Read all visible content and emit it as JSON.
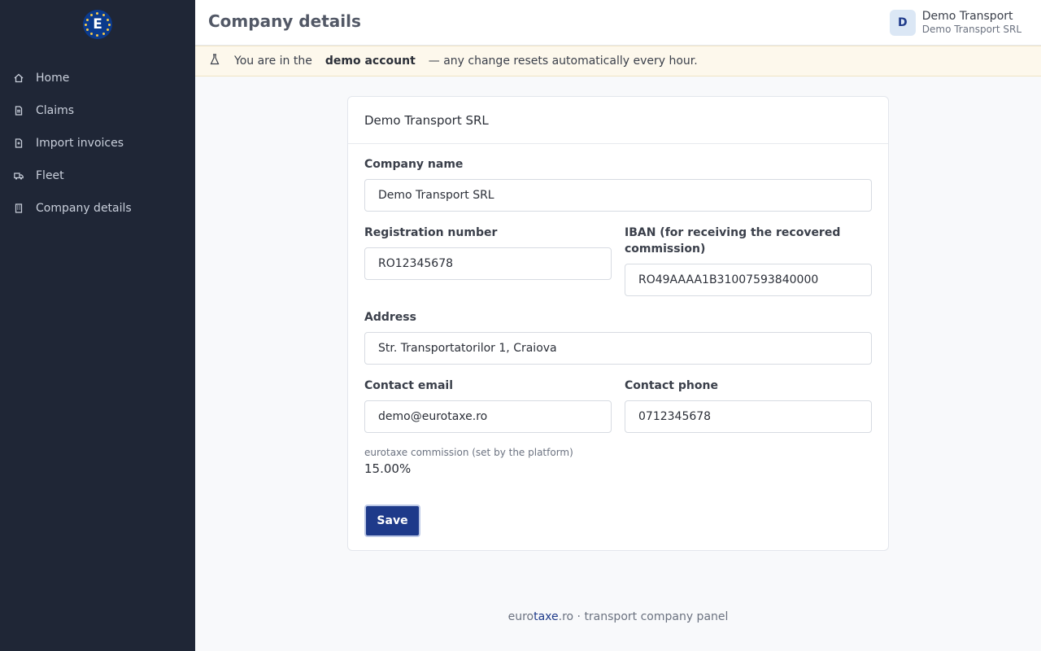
{
  "header": {
    "title": "Company details",
    "user": {
      "avatar_initial": "D",
      "name": "Demo Transport",
      "company": "Demo Transport SRL"
    }
  },
  "sidebar": {
    "logo_letter": "E",
    "items": [
      {
        "label": "Home",
        "icon": "home-icon"
      },
      {
        "label": "Claims",
        "icon": "document-icon"
      },
      {
        "label": "Import invoices",
        "icon": "file-icon"
      },
      {
        "label": "Fleet",
        "icon": "truck-icon"
      },
      {
        "label": "Company details",
        "icon": "building-icon"
      }
    ]
  },
  "banner": {
    "icon": "flask-icon",
    "prefix": "You are in the",
    "strong": "demo account",
    "suffix": "— any change resets automatically every hour."
  },
  "card": {
    "title": "Demo Transport SRL",
    "fields": {
      "company_name": {
        "label": "Company name",
        "value": "Demo Transport SRL"
      },
      "registration_number": {
        "label": "Registration number",
        "value": "RO12345678"
      },
      "iban": {
        "label": "IBAN (for receiving the recovered commission)",
        "value": "RO49AAAA1B31007593840000"
      },
      "address": {
        "label": "Address",
        "value": "Str. Transportatorilor 1, Craiova"
      },
      "contact_email": {
        "label": "Contact email",
        "value": "demo@eurotaxe.ro"
      },
      "contact_phone": {
        "label": "Contact phone",
        "value": "0712345678"
      }
    },
    "commission": {
      "label": "eurotaxe commission (set by the platform)",
      "value": "15.00%"
    },
    "save_label": "Save"
  },
  "footer": {
    "part1": "euro",
    "part2": "taxe",
    "part3": ".ro · transport company panel"
  },
  "colors": {
    "sidebar_bg": "#1f2636",
    "accent": "#1e3a8a",
    "banner_bg": "#fdf8ec"
  }
}
